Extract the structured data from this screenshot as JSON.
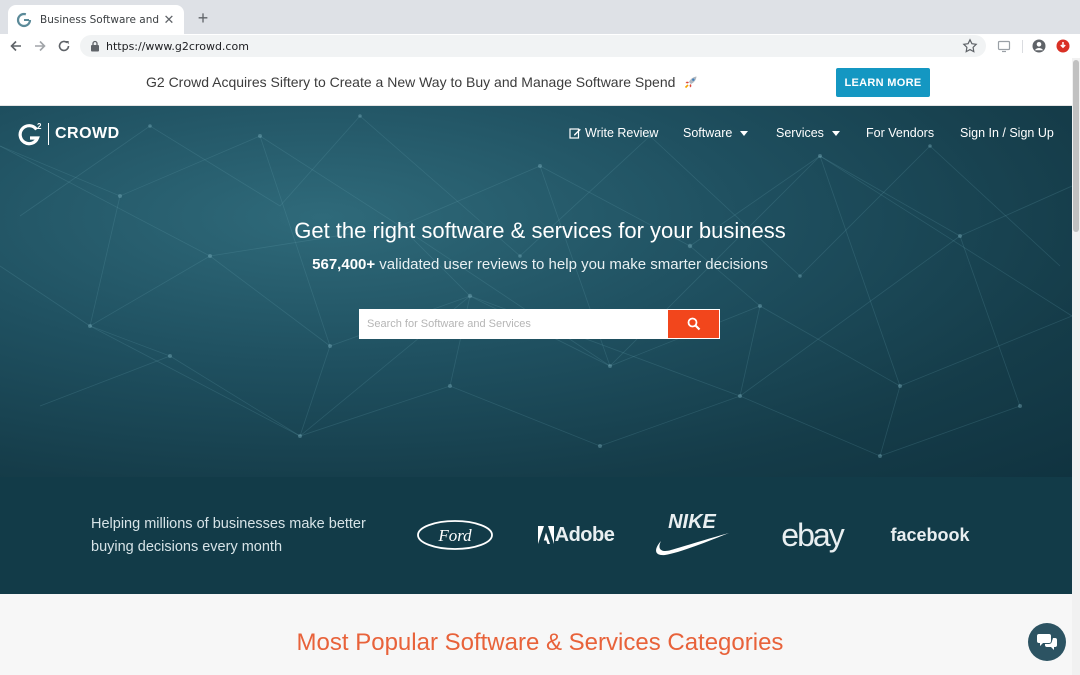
{
  "browser": {
    "tab_title": "Business Software and Service",
    "url": "https://www.g2crowd.com"
  },
  "announcement": {
    "message": "G2 Crowd Acquires Siftery to Create a New Way to Buy and Manage Software Spend",
    "cta": "LEARN MORE"
  },
  "header": {
    "logo_mark": "G",
    "logo_sup": "2",
    "logo_text": "CROWD",
    "nav": {
      "write_review": "Write Review",
      "software": "Software",
      "services": "Services",
      "for_vendors": "For Vendors",
      "sign_in": "Sign In / Sign Up"
    }
  },
  "hero": {
    "headline": "Get the right software & services for your business",
    "review_count": "567,400+",
    "subline_rest": " validated user reviews to help you make smarter decisions",
    "search_placeholder": "Search for Software and Services"
  },
  "trust": {
    "tagline": "Helping millions of businesses make better buying decisions every month",
    "brands": {
      "ford": "Ford",
      "adobe": "Adobe",
      "nike": "NIKE",
      "ebay": "ebay",
      "facebook": "facebook"
    }
  },
  "popular": {
    "heading": "Most Popular Software & Services Categories"
  },
  "colors": {
    "accent_orange": "#f2461c",
    "cta_blue": "#1497c2",
    "hero_dark": "#153c49",
    "heading_orange": "#e8623a"
  },
  "icons": [
    "back-icon",
    "forward-icon",
    "reload-icon",
    "lock-icon",
    "star-icon",
    "cast-icon",
    "profile-icon",
    "extension-icon",
    "pencil-icon",
    "search-icon",
    "chat-icon",
    "rocket-icon"
  ]
}
